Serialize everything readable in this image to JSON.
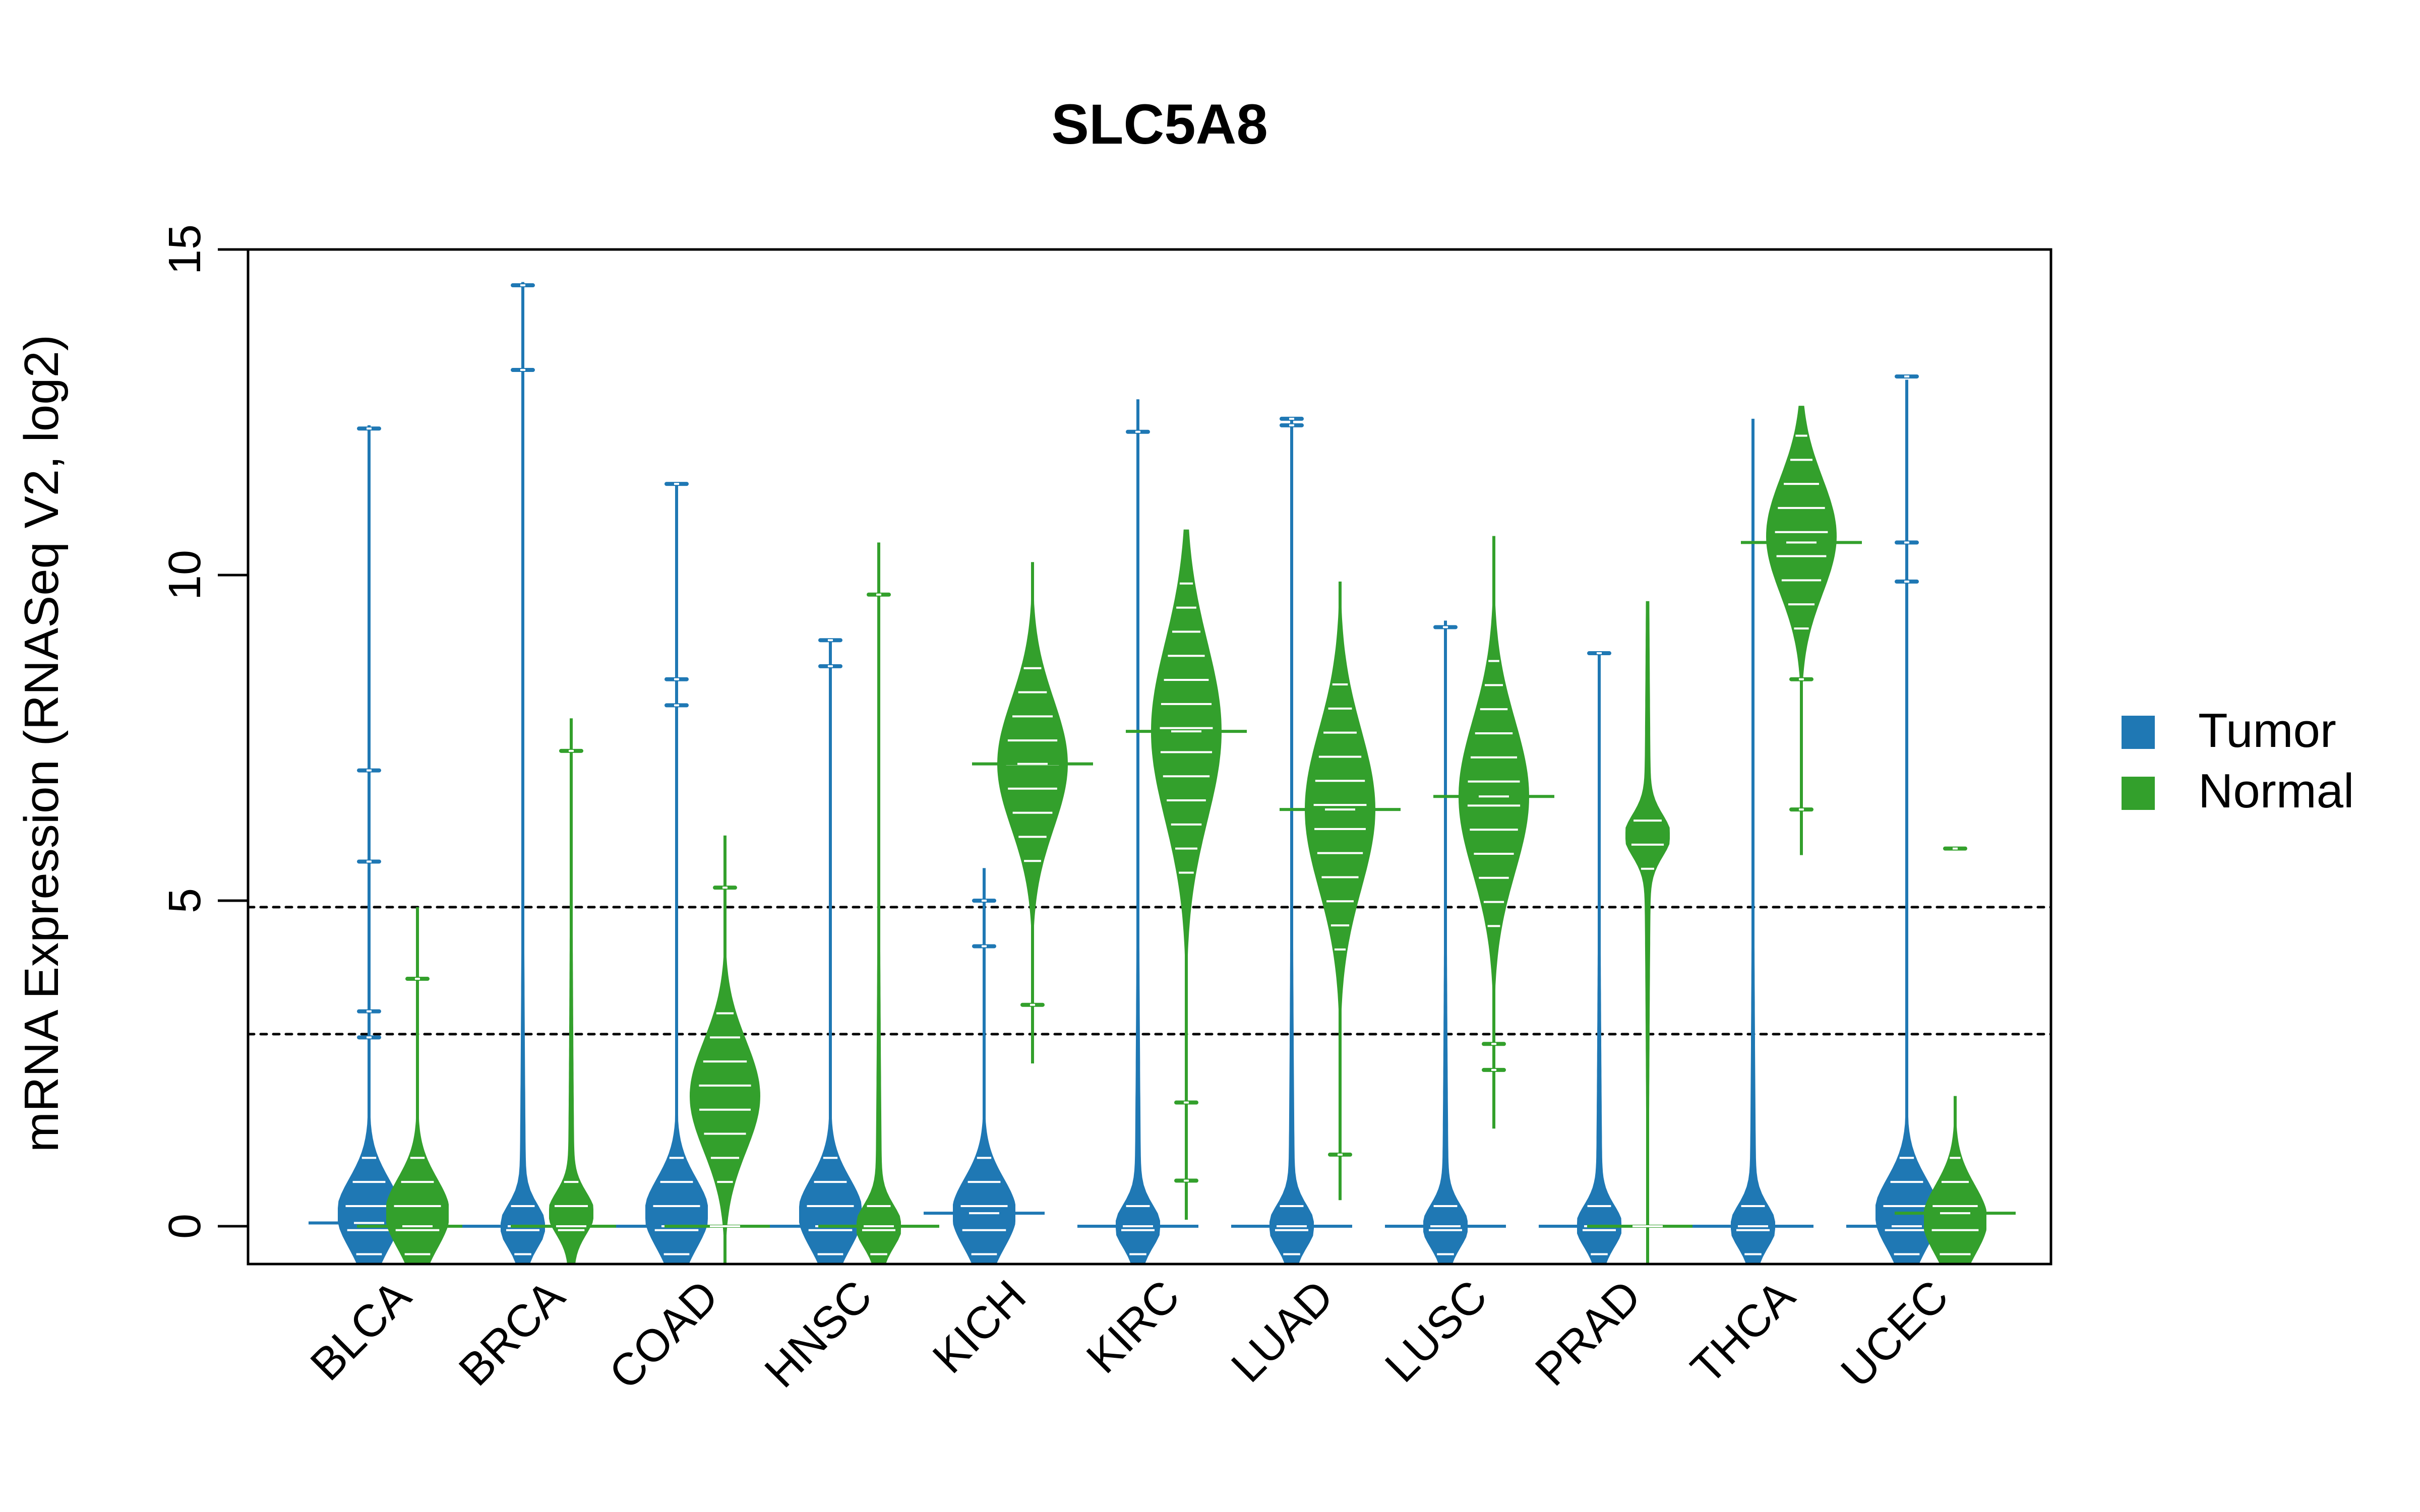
{
  "chart_data": {
    "type": "violin",
    "title": "SLC5A8",
    "xlabel": "",
    "ylabel": "mRNA Expression (RNASeq V2, log2)",
    "ylim": [
      -0.58,
      15
    ],
    "yticks": [
      0,
      5,
      10,
      15
    ],
    "grid": false,
    "reference_lines": [
      {
        "y": 4.9,
        "style": "dotted"
      },
      {
        "y": 2.95,
        "style": "dotted"
      }
    ],
    "legend": {
      "placement": "right",
      "entries": [
        {
          "name": "Tumor",
          "color": "#1F78B4"
        },
        {
          "name": "Normal",
          "color": "#33A02C"
        }
      ]
    },
    "categories": [
      "BLCA",
      "BRCA",
      "COAD",
      "HNSC",
      "KICH",
      "KIRC",
      "LUAD",
      "LUSC",
      "PRAD",
      "THCA",
      "UCEC"
    ],
    "series": [
      {
        "name": "Tumor",
        "color": "#1F78B4",
        "violins": [
          {
            "min": -0.6,
            "max": 12.3,
            "median": 0.05,
            "mode": 0.2,
            "spread": "bottom-heavy",
            "outliers": [
              12.25,
              7.0,
              5.6,
              3.3,
              2.9
            ]
          },
          {
            "min": -0.6,
            "max": 14.5,
            "median": 0.0,
            "mode": 0.0,
            "spread": "long-tail",
            "outliers": [
              14.45,
              13.15
            ]
          },
          {
            "min": -0.6,
            "max": 11.4,
            "median": 0.0,
            "mode": 0.2,
            "spread": "bottom-heavy",
            "outliers": [
              11.4,
              8.4,
              8.0
            ]
          },
          {
            "min": -0.6,
            "max": 9.0,
            "median": 0.0,
            "mode": 0.2,
            "spread": "bottom-heavy",
            "outliers": [
              9.0,
              8.6
            ]
          },
          {
            "min": -0.6,
            "max": 5.5,
            "median": 0.2,
            "mode": 0.2,
            "spread": "bottom-heavy",
            "outliers": [
              5.0,
              4.3
            ]
          },
          {
            "min": -0.6,
            "max": 12.7,
            "median": 0.0,
            "mode": 0.0,
            "spread": "long-tail",
            "outliers": [
              12.2
            ]
          },
          {
            "min": -0.6,
            "max": 12.4,
            "median": 0.0,
            "mode": 0.0,
            "spread": "long-tail",
            "outliers": [
              12.4,
              12.3
            ]
          },
          {
            "min": -0.6,
            "max": 9.3,
            "median": 0.0,
            "mode": 0.0,
            "spread": "long-tail",
            "outliers": [
              9.2
            ]
          },
          {
            "min": -0.6,
            "max": 8.8,
            "median": 0.0,
            "mode": 0.0,
            "spread": "long-tail",
            "outliers": [
              8.8
            ]
          },
          {
            "min": -0.6,
            "max": 12.4,
            "median": 0.0,
            "mode": 0.0,
            "spread": "long-tail",
            "outliers": []
          },
          {
            "min": -0.6,
            "max": 13.0,
            "median": 0.0,
            "mode": 0.2,
            "spread": "bottom-heavy",
            "outliers": [
              13.05,
              10.5,
              9.9
            ]
          }
        ]
      },
      {
        "name": "Normal",
        "color": "#33A02C",
        "violins": [
          {
            "min": -0.6,
            "max": 4.9,
            "median": 0.0,
            "mode": 0.2,
            "spread": "bottom-heavy",
            "outliers": [
              3.8
            ]
          },
          {
            "min": -0.6,
            "max": 7.8,
            "median": 0.0,
            "mode": 0.2,
            "spread": "long-tail",
            "outliers": [
              7.3
            ]
          },
          {
            "min": -0.6,
            "max": 6.0,
            "median": 0.0,
            "mode": 2.0,
            "spread": "spindle",
            "outliers": [
              5.2
            ]
          },
          {
            "min": -0.6,
            "max": 10.5,
            "median": 0.0,
            "mode": 0.0,
            "spread": "long-tail",
            "outliers": [
              9.7
            ]
          },
          {
            "min": 2.5,
            "max": 10.2,
            "median": 7.1,
            "mode": 7.1,
            "spread": "spindle",
            "outliers": [
              3.4
            ]
          },
          {
            "min": 0.1,
            "max": 10.7,
            "median": 7.6,
            "mode": 7.6,
            "spread": "spindle",
            "outliers": [
              1.9,
              0.7
            ]
          },
          {
            "min": 0.4,
            "max": 9.9,
            "median": 6.4,
            "mode": 6.4,
            "spread": "spindle",
            "outliers": [
              1.1
            ]
          },
          {
            "min": 1.5,
            "max": 10.6,
            "median": 6.6,
            "mode": 6.6,
            "spread": "spindle",
            "outliers": [
              2.8,
              2.4
            ]
          },
          {
            "min": -0.6,
            "max": 9.6,
            "median": 0.0,
            "mode": 6.0,
            "spread": "long-tail",
            "outliers": []
          },
          {
            "min": 5.7,
            "max": 12.6,
            "median": 10.5,
            "mode": 10.6,
            "spread": "spindle",
            "outliers": [
              8.4,
              6.4
            ]
          },
          {
            "min": -0.6,
            "max": 2.0,
            "median": 0.2,
            "mode": 0.1,
            "spread": "bottom-heavy",
            "outliers": [
              5.8
            ]
          }
        ]
      }
    ]
  }
}
